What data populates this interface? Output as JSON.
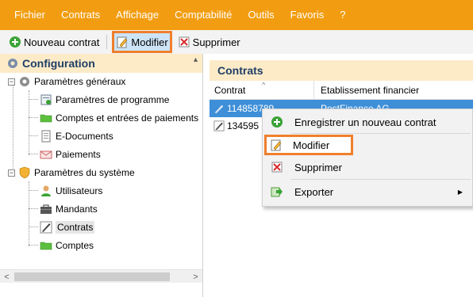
{
  "menubar": {
    "items": [
      "Fichier",
      "Contrats",
      "Affichage",
      "Comptabilité",
      "Outils",
      "Favoris",
      "?"
    ]
  },
  "toolbar": {
    "new_contract": "Nouveau contrat",
    "modify": "Modifier",
    "delete": "Supprimer"
  },
  "sidebar": {
    "title": "Configuration",
    "tree": [
      {
        "label": "Paramètres généraux",
        "icon": "gear-icon",
        "level": 0,
        "expander": "−"
      },
      {
        "label": "Paramètres de programme",
        "icon": "settings-document-icon",
        "level": 1
      },
      {
        "label": "Comptes et entrées de paiements",
        "icon": "folder-icon",
        "level": 1
      },
      {
        "label": "E-Documents",
        "icon": "document-icon",
        "level": 1
      },
      {
        "label": "Paiements",
        "icon": "envelope-icon",
        "level": 1
      },
      {
        "label": "Paramètres du système",
        "icon": "shield-icon",
        "level": 0,
        "expander": "−"
      },
      {
        "label": "Utilisateurs",
        "icon": "user-icon",
        "level": 1
      },
      {
        "label": "Mandants",
        "icon": "briefcase-icon",
        "level": 1
      },
      {
        "label": "Contrats",
        "icon": "contract-pen-icon",
        "level": 1,
        "selected": true
      },
      {
        "label": "Comptes",
        "icon": "folder-icon",
        "level": 1
      }
    ]
  },
  "content": {
    "title": "Contrats",
    "columns": [
      "Contrat",
      "Etablissement financier"
    ],
    "rows": [
      {
        "contract": "114858789",
        "institution": "PostFinance AG",
        "selected": true
      },
      {
        "contract": "134595",
        "institution": ""
      }
    ]
  },
  "context_menu": {
    "items": [
      {
        "label": "Enregistrer un nouveau contrat",
        "icon": "add-icon"
      },
      {
        "label": "Modifier",
        "icon": "edit-icon",
        "highlighted": true
      },
      {
        "label": "Supprimer",
        "icon": "delete-icon"
      },
      {
        "label": "Exporter",
        "icon": "export-icon",
        "submenu": true
      }
    ]
  },
  "colors": {
    "menubar": "#f29d11",
    "panel_header": "#fdebc8",
    "selection": "#3e8fd8",
    "highlight_box": "#f07f2c"
  }
}
